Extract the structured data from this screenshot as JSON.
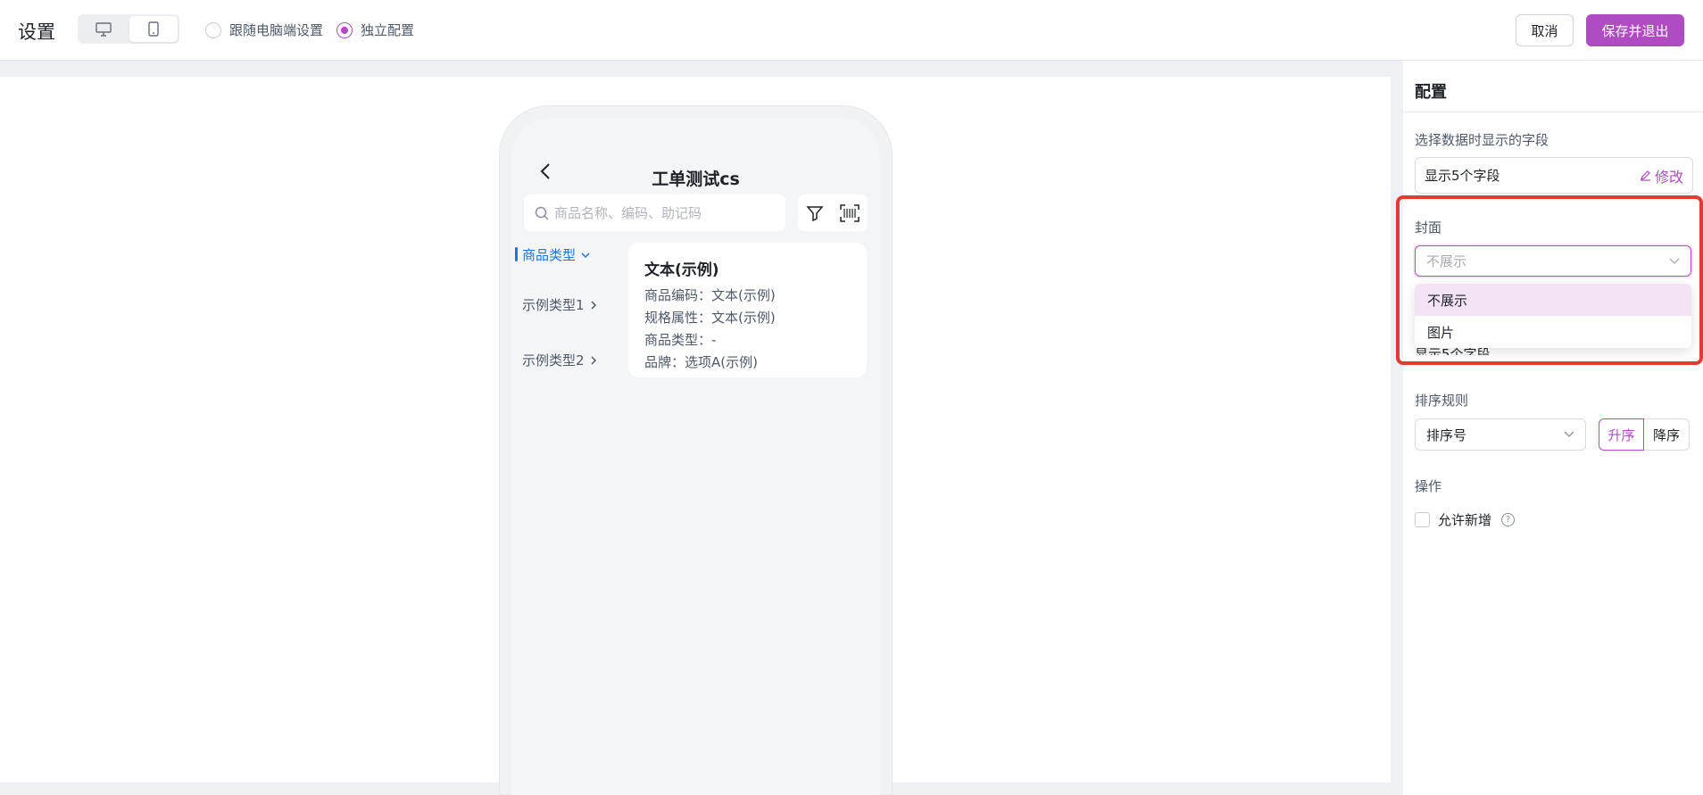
{
  "topbar": {
    "title": "设置",
    "radio_follow": "跟随电脑端设置",
    "radio_independent": "独立配置",
    "cancel": "取消",
    "save": "保存并退出"
  },
  "phone": {
    "title": "工单测试cs",
    "search_placeholder": "商品名称、编码、助记码",
    "categories": [
      "商品类型",
      "示例类型1",
      "示例类型2"
    ],
    "card": {
      "title": "文本(示例)",
      "rows": [
        "商品编码：文本(示例)",
        "规格属性：文本(示例)",
        "商品类型：-",
        "品牌：选项A(示例)"
      ]
    }
  },
  "panel": {
    "header": "配置",
    "fields_label": "选择数据时显示的字段",
    "fields_value": "显示5个字段",
    "edit": "修改",
    "cover_label": "封面",
    "cover_placeholder": "不展示",
    "cover_options": [
      "不展示",
      "图片"
    ],
    "hidden_row": "显示5个字段",
    "sort_label": "排序规则",
    "sort_value": "排序号",
    "asc": "升序",
    "desc": "降序",
    "action_label": "操作",
    "allow_add": "允许新增",
    "help": "?"
  },
  "colors": {
    "accent": "#b04cc2",
    "link_blue": "#1f74e0",
    "highlight": "#e53935"
  }
}
